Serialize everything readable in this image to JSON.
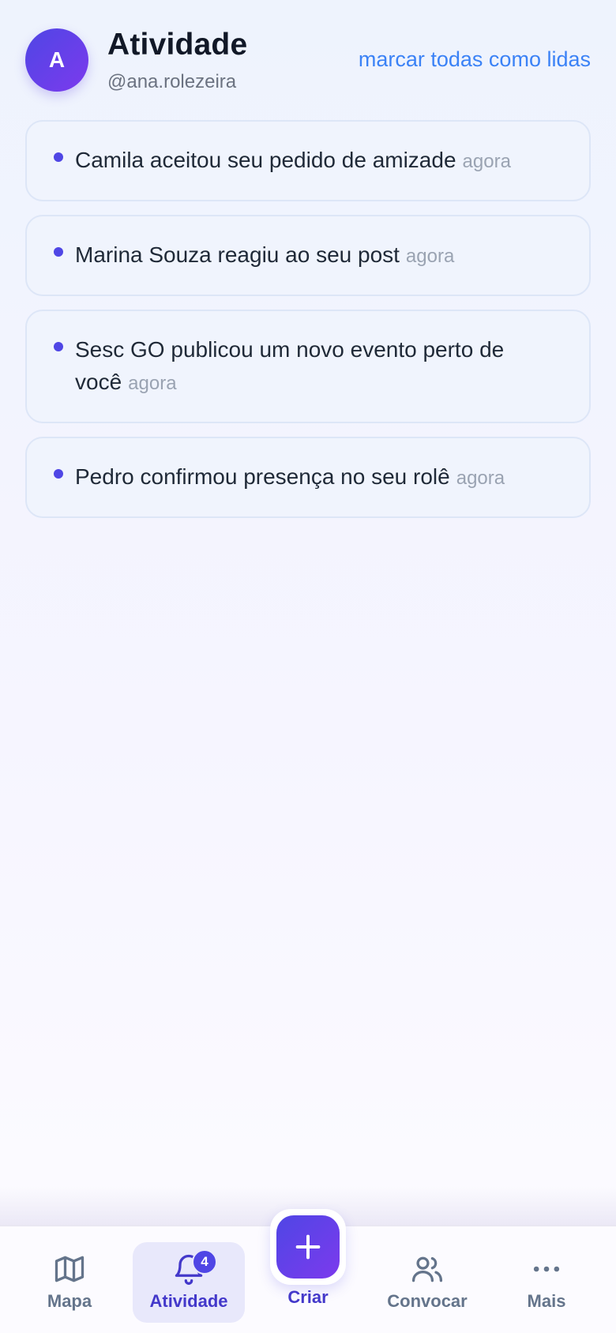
{
  "header": {
    "avatar_initial": "A",
    "title": "Atividade",
    "handle": "@ana.rolezeira",
    "mark_all_label": "marcar todas como lidas"
  },
  "notifications": [
    {
      "text": "Camila aceitou seu pedido de amizade",
      "time": "agora",
      "unread": true
    },
    {
      "text": "Marina Souza reagiu ao seu post",
      "time": "agora",
      "unread": true
    },
    {
      "text": "Sesc GO publicou um novo evento perto de você",
      "time": "agora",
      "unread": true
    },
    {
      "text": "Pedro confirmou presença no seu rolê",
      "time": "agora",
      "unread": true
    }
  ],
  "bottom_nav": {
    "items": [
      {
        "label": "Mapa",
        "icon": "map-icon"
      },
      {
        "label": "Atividade",
        "icon": "bell-icon",
        "badge": "4",
        "active": true
      },
      {
        "label": "Criar",
        "icon": "plus-icon"
      },
      {
        "label": "Convocar",
        "icon": "users-icon"
      },
      {
        "label": "Mais",
        "icon": "more-horizontal-icon"
      }
    ]
  },
  "colors": {
    "accent": "#4f46e5",
    "accent_gradient_end": "#7c3aed",
    "link": "#3b82f6",
    "card_bg": "#f0f4fd",
    "muted_text": "#9aa3b2"
  }
}
